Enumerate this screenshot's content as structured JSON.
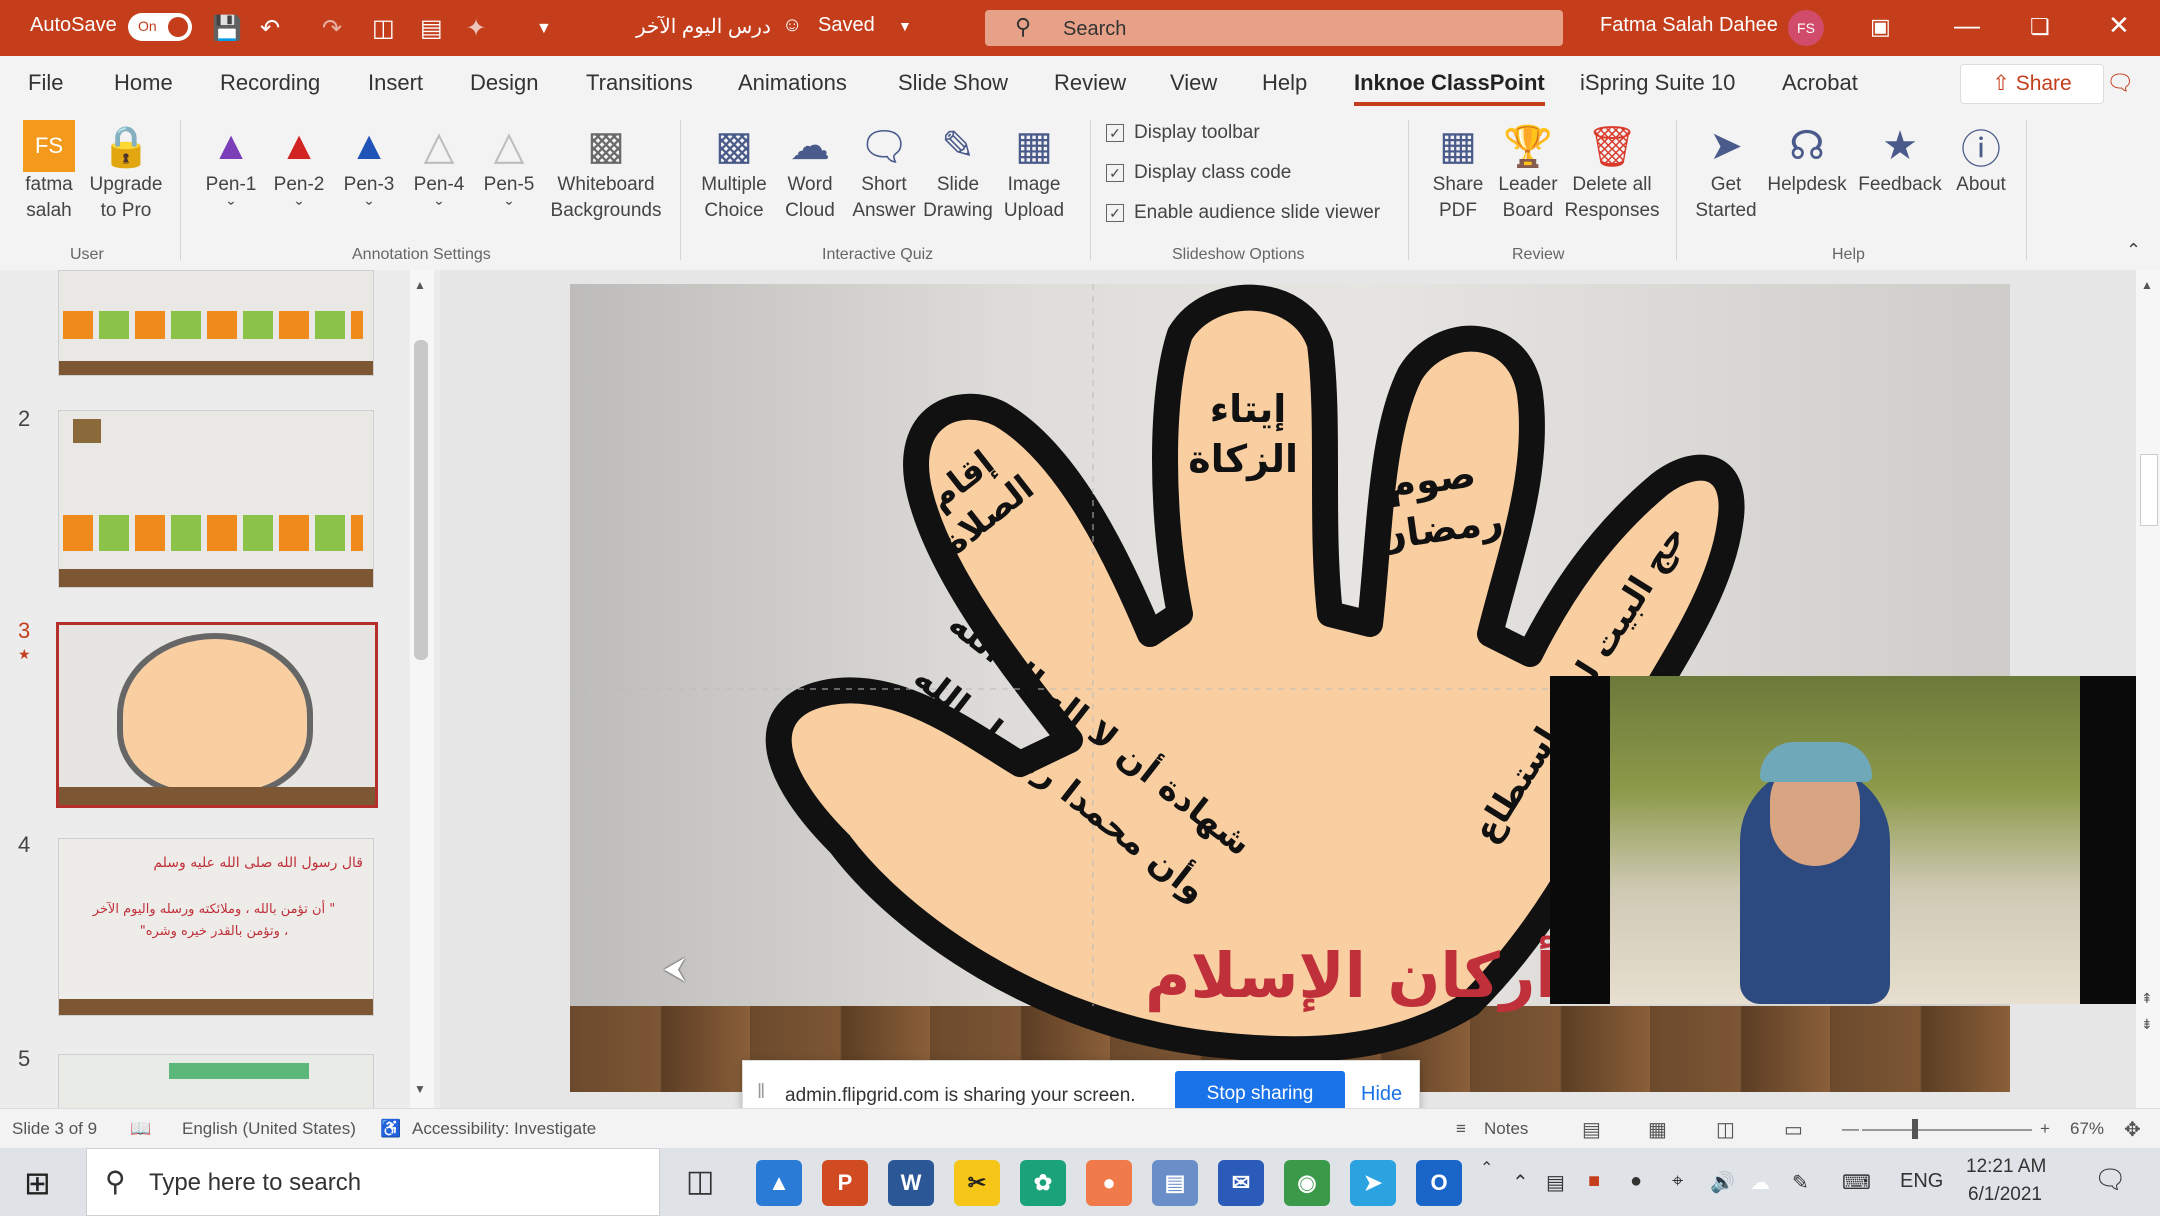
{
  "titlebar": {
    "autosave_label": "AutoSave",
    "autosave_state": "On",
    "doc_title": "درس اليوم الآخر",
    "saved_label": "Saved",
    "search_placeholder": "Search",
    "user_name": "Fatma Salah Dahee",
    "user_initials": "FS"
  },
  "menu": [
    "File",
    "Home",
    "Recording",
    "Insert",
    "Design",
    "Transitions",
    "Animations",
    "Slide Show",
    "Review",
    "View",
    "Help",
    "Inknoe ClassPoint",
    "iSpring Suite 10",
    "Acrobat"
  ],
  "share_label": "Share",
  "ribbon": {
    "user": {
      "fatma": [
        "fatma",
        "salah"
      ],
      "upgrade": [
        "Upgrade",
        "to Pro"
      ],
      "group": "User",
      "initials": "FS"
    },
    "pens": [
      "Pen-1",
      "Pen-2",
      "Pen-3",
      "Pen-4",
      "Pen-5"
    ],
    "whiteboard": [
      "Whiteboard",
      "Backgrounds"
    ],
    "annotation_group": "Annotation Settings",
    "quiz": [
      [
        "Multiple",
        "Choice"
      ],
      [
        "Word",
        "Cloud"
      ],
      [
        "Short",
        "Answer"
      ],
      [
        "Slide",
        "Drawing"
      ],
      [
        "Image",
        "Upload"
      ]
    ],
    "quiz_group": "Interactive Quiz",
    "options": [
      "Display toolbar",
      "Display class code",
      "Enable audience slide viewer"
    ],
    "options_group": "Slideshow Options",
    "review": [
      [
        "Share",
        "PDF"
      ],
      [
        "Leader",
        "Board"
      ],
      [
        "Delete all",
        "Responses"
      ]
    ],
    "review_group": "Review",
    "help": [
      [
        "Get",
        "Started"
      ],
      [
        "Helpdesk"
      ],
      [
        "Feedback"
      ],
      [
        "About"
      ]
    ],
    "help_group": "Help"
  },
  "thumbnails": {
    "numbers": [
      "2",
      "3",
      "4",
      "5"
    ],
    "slide4_heading": "قال رسول الله صلى الله عليه وسلم",
    "slide4_body": "\" أن تؤمن بالله ، وملائكته ورسله واليوم الآخر ، وتؤمن بالقدر خيره وشره\""
  },
  "slide": {
    "finger1": "إقام الصلاة",
    "finger2": "إيتاء الزكاة",
    "finger3": "صوم رمضان",
    "finger4": "حج البيت لمن استطاع",
    "thumb_line1": "شهادة أن لا إله إلا الله",
    "thumb_line2": "وأن محمدا رسول الله",
    "title": "أركان الإسلام"
  },
  "sharebar": {
    "message": "admin.flipgrid.com is sharing your screen.",
    "stop": "Stop sharing",
    "hide": "Hide"
  },
  "status": {
    "slide_info": "Slide 3 of 9",
    "language": "English (United States)",
    "accessibility": "Accessibility: Investigate",
    "notes": "Notes",
    "zoom": "67%"
  },
  "taskbar": {
    "search_placeholder": "Type here to search",
    "lang": "ENG",
    "time": "12:21 AM",
    "date": "6/1/2021"
  },
  "colors": {
    "accent": "#c43e1c",
    "hand": "#f9cfa2",
    "title": "#c0303a"
  }
}
